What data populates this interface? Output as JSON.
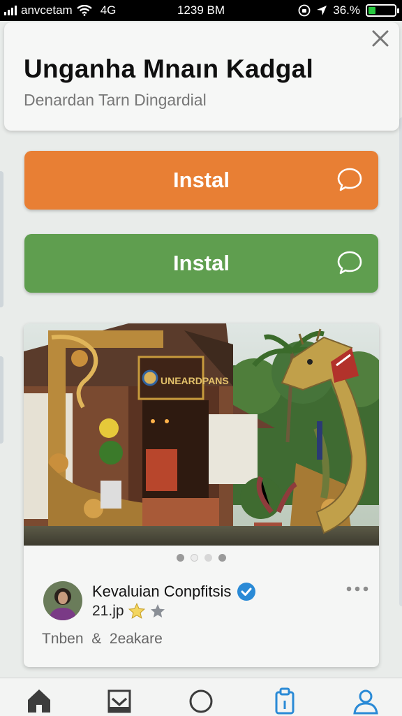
{
  "status_bar": {
    "carrier": "anvcetam",
    "network": "4G",
    "time": "1239 BM",
    "battery": "36.%",
    "battery_level": 0.36
  },
  "header": {
    "title": "Unganha Mnaın Kadgal",
    "subtitle": "Denardan Tarn Dingardial"
  },
  "buttons": [
    {
      "label": "Instal",
      "color": "#e87f34"
    },
    {
      "label": "Instal",
      "color": "#5f9e4f"
    }
  ],
  "post": {
    "sign_text": "UNEARDPANS",
    "author": "Kevaluian Conpfitsis",
    "meta": "21.jp",
    "caption": "Tnben  &  2eakare",
    "carousel_pages": 4,
    "carousel_active": 2
  },
  "bottom_nav": {
    "items": [
      "home-icon",
      "inbox-icon",
      "circle-icon",
      "clipboard-icon",
      "profile-icon"
    ],
    "active_index": 3,
    "accent_color": "#2a8ad6"
  }
}
